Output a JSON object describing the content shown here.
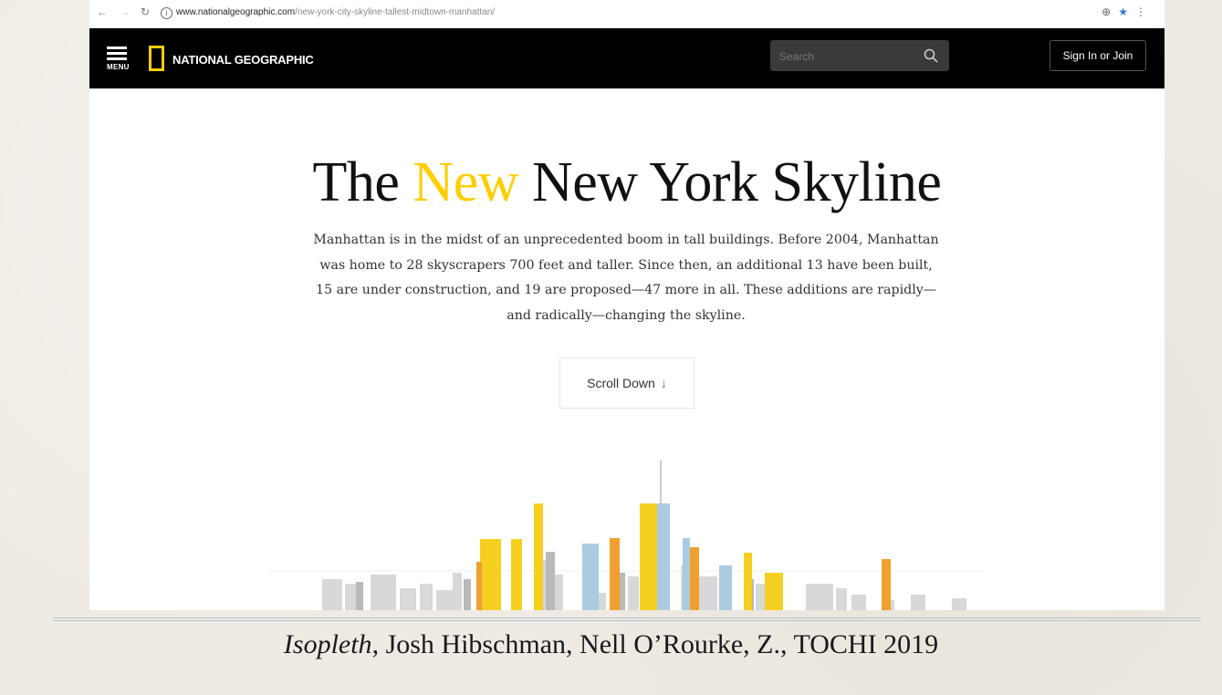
{
  "browser": {
    "url_host": "www.nationalgeographic.com",
    "url_path": "/new-york-city-skyline-tallest-midtown-manhattan/",
    "back_icon": "back-arrow-icon",
    "forward_icon": "forward-arrow-icon",
    "reload_icon": "reload-icon"
  },
  "header": {
    "menu_label": "MENU",
    "logo_text": "NATIONAL GEOGRAPHIC",
    "search_placeholder": "Search",
    "signin_label": "Sign In or Join",
    "brand_color": "#ffce00"
  },
  "article": {
    "title_part1": "The ",
    "title_accent": "New",
    "title_part2": " New York Skyline",
    "intro": "Manhattan is in the midst of an unprecedented boom in tall buildings. Before 2004, Manhattan was home to 28 skyscrapers 700 feet and taller. Since then, an additional 13 have been built, 15 are under construction, and 19 are proposed—47 more in all. These additions are rapidly—and radically—changing the skyline.",
    "scroll_label": "Scroll Down"
  },
  "caption": {
    "title": "Isopleth",
    "rest": ", Josh Hibschman, Nell O’Rourke, Z., TOCHI 2019"
  }
}
